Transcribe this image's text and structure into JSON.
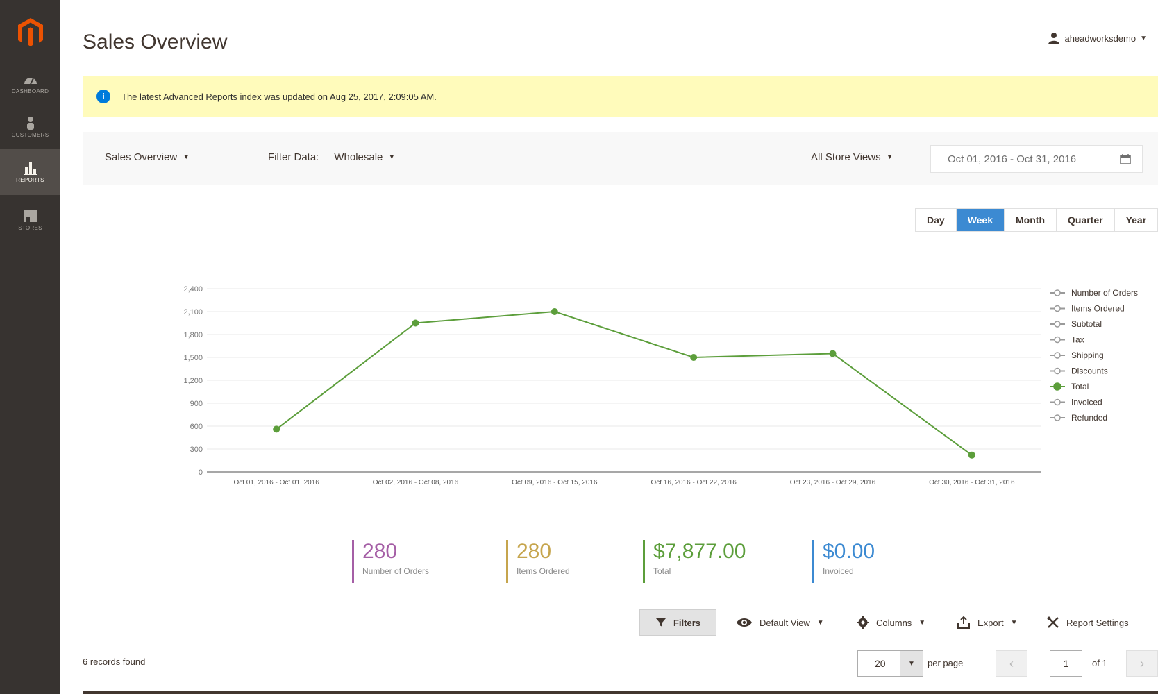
{
  "sidebar": {
    "items": [
      {
        "label": "Dashboard",
        "icon": "dashboard-icon",
        "active": false
      },
      {
        "label": "Customers",
        "icon": "customers-icon",
        "active": false
      },
      {
        "label": "Reports",
        "icon": "reports-icon",
        "active": true
      },
      {
        "label": "Stores",
        "icon": "stores-icon",
        "active": false
      }
    ]
  },
  "header": {
    "title": "Sales Overview",
    "user": "aheadworksdemo"
  },
  "notice": {
    "text": "The latest Advanced Reports index was updated on Aug 25, 2017, 2:09:05 AM."
  },
  "filters": {
    "report": "Sales Overview",
    "filter_label": "Filter Data:",
    "filter_value": "Wholesale",
    "store_view": "All Store Views",
    "date_range": "Oct 01, 2016  -  Oct 31, 2016"
  },
  "period_tabs": [
    {
      "label": "Day",
      "active": false
    },
    {
      "label": "Week",
      "active": true
    },
    {
      "label": "Month",
      "active": false
    },
    {
      "label": "Quarter",
      "active": false
    },
    {
      "label": "Year",
      "active": false
    }
  ],
  "chart_data": {
    "type": "line",
    "categories": [
      "Oct 01, 2016 - Oct 01, 2016",
      "Oct 02, 2016 - Oct 08, 2016",
      "Oct 09, 2016 - Oct 15, 2016",
      "Oct 16, 2016 - Oct 22, 2016",
      "Oct 23, 2016 - Oct 29, 2016",
      "Oct 30, 2016 - Oct 31, 2016"
    ],
    "series": [
      {
        "name": "Total",
        "values": [
          560,
          1950,
          2100,
          1500,
          1550,
          220
        ],
        "color": "#5c9e3b"
      }
    ],
    "legend": [
      "Number of Orders",
      "Items Ordered",
      "Subtotal",
      "Tax",
      "Shipping",
      "Discounts",
      "Total",
      "Invoiced",
      "Refunded"
    ],
    "legend_active": "Total",
    "legend_position": "right",
    "yticks": [
      "0",
      "300",
      "600",
      "900",
      "1,200",
      "1,500",
      "1,800",
      "2,100",
      "2,400"
    ],
    "ylim": [
      0,
      2400
    ],
    "grid": true
  },
  "totals": [
    {
      "value": "280",
      "label": "Number of Orders",
      "color": "#a55fa6"
    },
    {
      "value": "280",
      "label": "Items Ordered",
      "color": "#c6a54d"
    },
    {
      "value": "$7,877.00",
      "label": "Total",
      "color": "#5c9e3b"
    },
    {
      "value": "$0.00",
      "label": "Invoiced",
      "color": "#3c8ad2"
    }
  ],
  "toolbar": {
    "filters": "Filters",
    "view": "Default View",
    "columns": "Columns",
    "export": "Export",
    "settings": "Report Settings"
  },
  "grid": {
    "records": "6 records found",
    "per_page_value": "20",
    "per_page_label": "per page",
    "page": "1",
    "of_pages": "of 1"
  }
}
